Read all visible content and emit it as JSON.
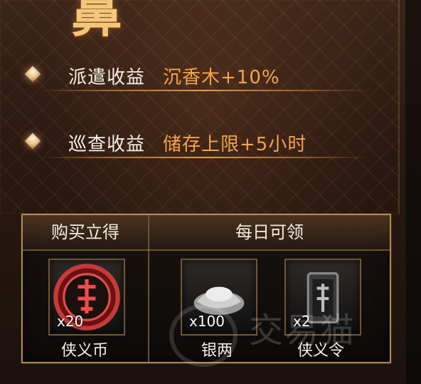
{
  "title": {
    "glyph": "鼻"
  },
  "benefits": [
    {
      "label": "派遣收益",
      "value": "沉香木+10%"
    },
    {
      "label": "巡查收益",
      "value": "储存上限+5小时"
    }
  ],
  "panel": {
    "left_header": "购买立得",
    "right_header": "每日可领",
    "items": [
      {
        "qty": "x20",
        "name": "侠义币",
        "icon": "xiayi-coin-icon"
      },
      {
        "qty": "x100",
        "name": "银两",
        "icon": "silver-ingot-icon"
      },
      {
        "qty": "x2",
        "name": "侠义令",
        "icon": "xiayi-token-icon"
      }
    ]
  },
  "watermark": {
    "text": "交易猫"
  },
  "colors": {
    "accent_orange": "#f4a54a",
    "gold": "#b48a4a"
  }
}
